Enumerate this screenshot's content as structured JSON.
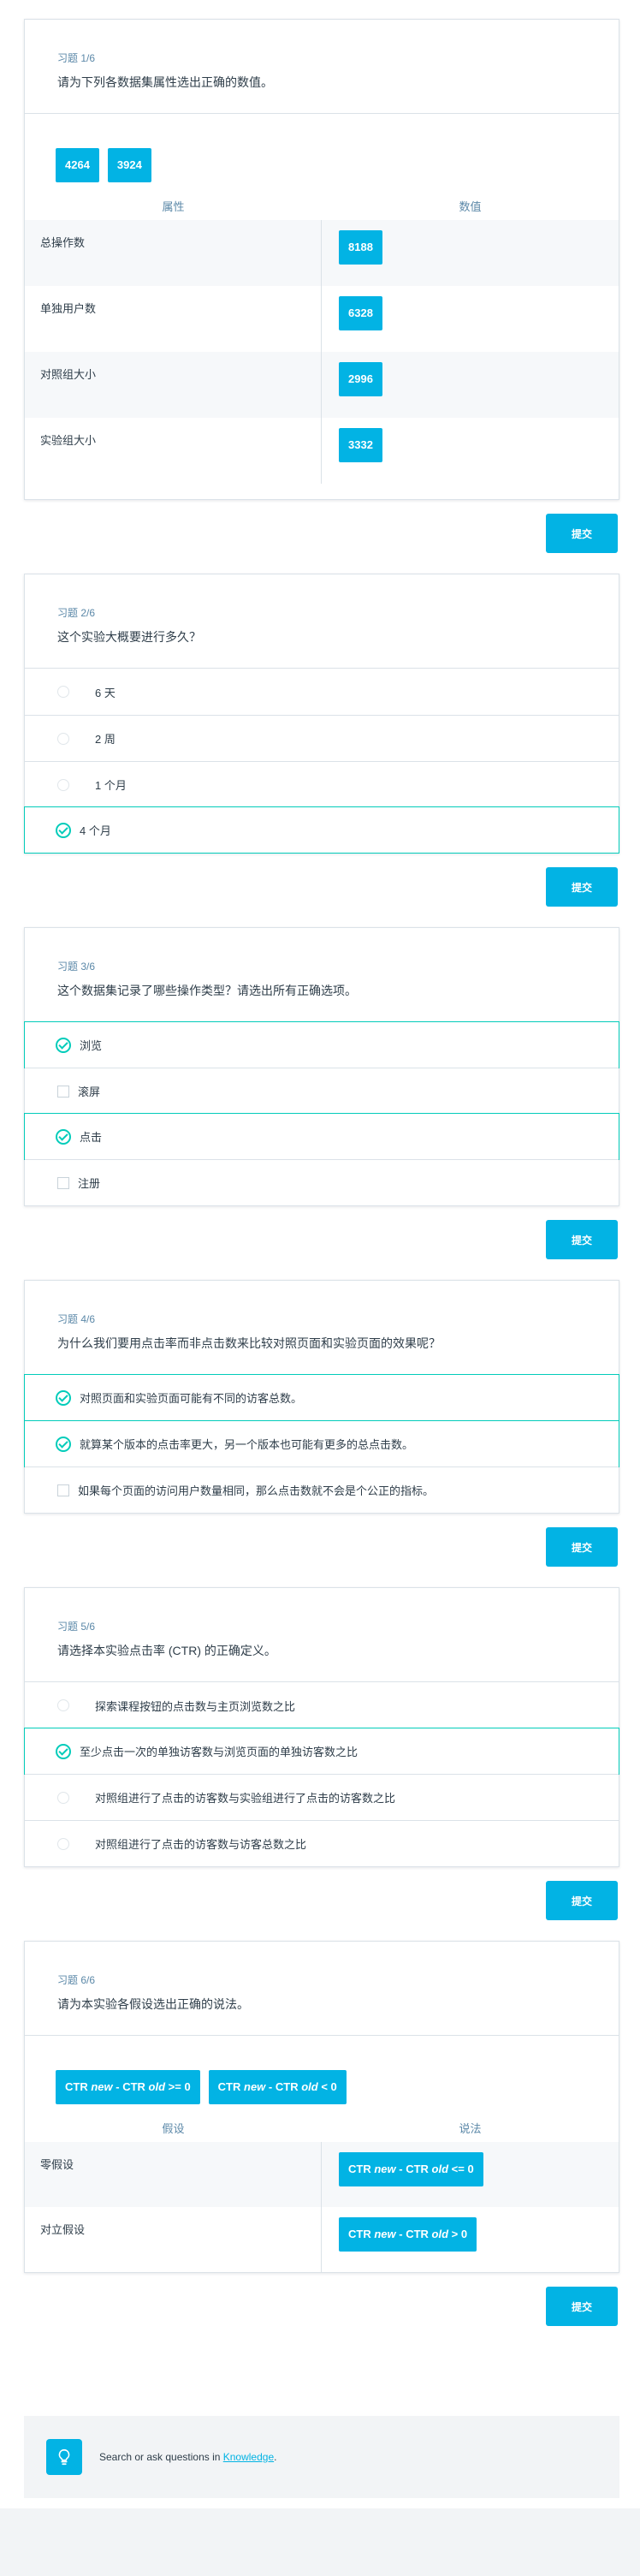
{
  "quiz1": {
    "label": "习题 1/6",
    "question": "请为下列各数据集属性选出正确的数值。",
    "chips": [
      "4264",
      "3924"
    ],
    "col_attr": "属性",
    "col_value": "数值",
    "rows": [
      {
        "label": "总操作数",
        "value": "8188"
      },
      {
        "label": "单独用户数",
        "value": "6328"
      },
      {
        "label": "对照组大小",
        "value": "2996"
      },
      {
        "label": "实验组大小",
        "value": "3332"
      }
    ],
    "submit": "提交"
  },
  "quiz2": {
    "label": "习题 2/6",
    "question": "这个实验大概要进行多久？",
    "options": [
      {
        "text": "6 天",
        "selected": false
      },
      {
        "text": "2 周",
        "selected": false
      },
      {
        "text": "1 个月",
        "selected": false
      },
      {
        "text": "4 个月",
        "selected": true
      }
    ],
    "submit": "提交"
  },
  "quiz3": {
    "label": "习题 3/6",
    "question": "这个数据集记录了哪些操作类型？请选出所有正确选项。",
    "options": [
      {
        "text": "浏览",
        "selected": true
      },
      {
        "text": "滚屏",
        "selected": false
      },
      {
        "text": "点击",
        "selected": true
      },
      {
        "text": "注册",
        "selected": false
      }
    ],
    "submit": "提交"
  },
  "quiz4": {
    "label": "习题 4/6",
    "question": "为什么我们要用点击率而非点击数来比较对照页面和实验页面的效果呢？",
    "options": [
      {
        "text": "对照页面和实验页面可能有不同的访客总数。",
        "selected": true
      },
      {
        "text": "就算某个版本的点击率更大，另一个版本也可能有更多的总点击数。",
        "selected": true
      },
      {
        "text": "如果每个页面的访问用户数量相同，那么点击数就不会是个公正的指标。",
        "selected": false
      }
    ],
    "submit": "提交"
  },
  "quiz5": {
    "label": "习题 5/6",
    "question": "请选择本实验点击率 (CTR) 的正确定义。",
    "options": [
      {
        "text": "探索课程按钮的点击数与主页浏览数之比",
        "selected": false
      },
      {
        "text": "至少点击一次的单独访客数与浏览页面的单独访客数之比",
        "selected": true
      },
      {
        "text": "对照组进行了点击的访客数与实验组进行了点击的访客数之比",
        "selected": false
      },
      {
        "text": "对照组进行了点击的访客数与访客总数之比",
        "selected": false
      }
    ],
    "submit": "提交"
  },
  "quiz6": {
    "label": "习题 6/6",
    "question": "请为本实验各假设选出正确的说法。",
    "chips": [
      {
        "pre": "CTR ",
        "a": "new",
        "mid": " - CTR ",
        "b": "old",
        "post": " >= 0"
      },
      {
        "pre": "CTR ",
        "a": "new",
        "mid": " - CTR ",
        "b": "old",
        "post": " < 0"
      }
    ],
    "col_attr": "假设",
    "col_value": "说法",
    "rows": [
      {
        "label": "零假设",
        "value": {
          "pre": "CTR ",
          "a": "new",
          "mid": " - CTR ",
          "b": "old",
          "post": " <= 0"
        }
      },
      {
        "label": "对立假设",
        "value": {
          "pre": "CTR ",
          "a": "new",
          "mid": " - CTR ",
          "b": "old",
          "post": " > 0"
        }
      }
    ],
    "submit": "提交"
  },
  "knowledge": {
    "icon": "lightbulb-icon",
    "text_before": "Search or ask questions in ",
    "link": "Knowledge",
    "text_after": "."
  },
  "colors": {
    "accent": "#02b3e4",
    "success": "#02ccba",
    "border": "#dbe2e8"
  }
}
